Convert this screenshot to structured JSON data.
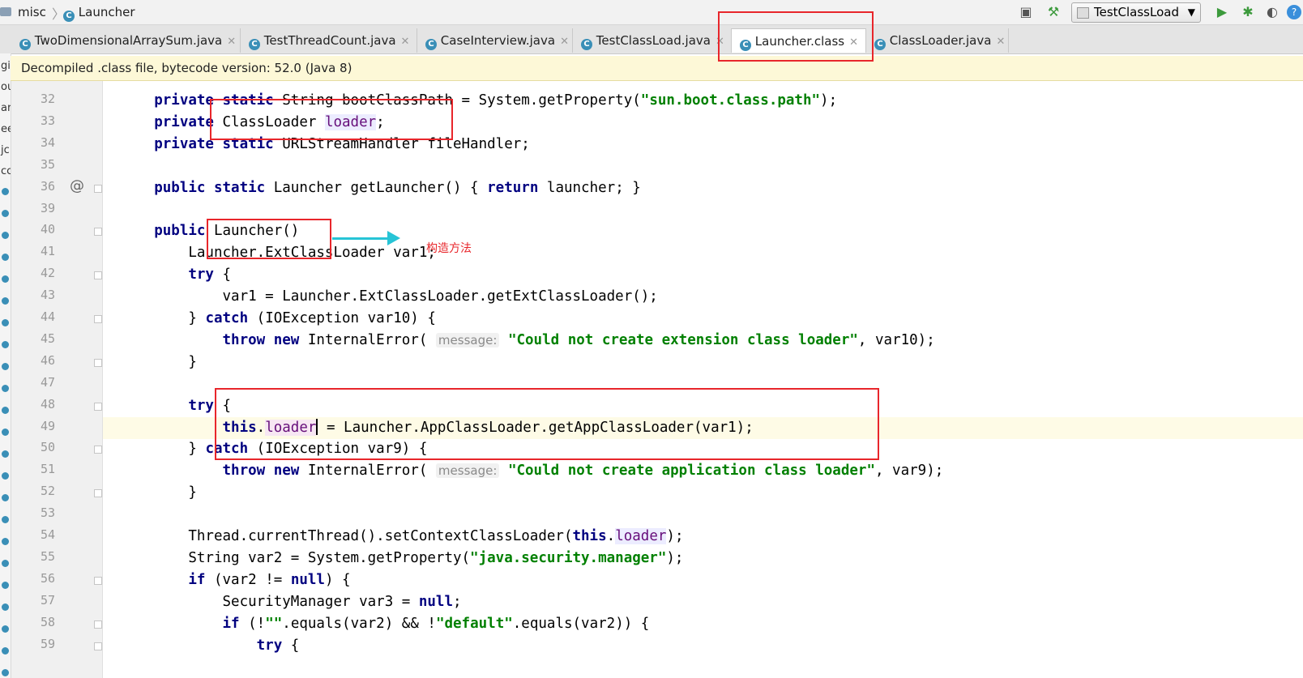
{
  "breadcrumb": {
    "project": "misc",
    "file": "Launcher"
  },
  "toolbar": {
    "run_config": "TestClassLoad"
  },
  "tabs": [
    {
      "label": "TwoDimensionalArraySum.java"
    },
    {
      "label": "TestThreadCount.java"
    },
    {
      "label": "CaseInterview.java"
    },
    {
      "label": "TestClassLoad.java"
    },
    {
      "label": "Launcher.class",
      "active": true
    },
    {
      "label": "ClassLoader.java"
    }
  ],
  "banner": {
    "text": "Decompiled .class file, bytecode version: 52.0 (Java 8)"
  },
  "left_strip": [
    "gi",
    "ou",
    "ar",
    "ee",
    "jc",
    "cc"
  ],
  "gutter": {
    "line_numbers": [
      "32",
      "33",
      "34",
      "35",
      "36",
      "39",
      "40",
      "41",
      "42",
      "43",
      "44",
      "45",
      "46",
      "47",
      "48",
      "49",
      "50",
      "51",
      "52",
      "53",
      "54",
      "55",
      "56",
      "57",
      "58",
      "59"
    ]
  },
  "code": {
    "lines": [
      {
        "t": [
          [
            "kw",
            "private static "
          ],
          [
            "",
            "String bootClassPath = System.getProperty("
          ],
          [
            "str",
            "\"sun.boot.class.path\""
          ],
          [
            "",
            ");"
          ]
        ]
      },
      {
        "t": [
          [
            "kw",
            "private "
          ],
          [
            "",
            "ClassLoader "
          ],
          [
            "fld",
            "loader"
          ],
          [
            "",
            ";"
          ]
        ]
      },
      {
        "t": [
          [
            "kw",
            "private static "
          ],
          [
            "",
            "URLStreamHandler fileHandler;"
          ]
        ]
      },
      {
        "t": [
          [
            "",
            ""
          ]
        ]
      },
      {
        "t": [
          [
            "kw",
            "public static "
          ],
          [
            "",
            "Launcher getLauncher() { "
          ],
          [
            "kw",
            "return "
          ],
          [
            "",
            "launcher; }"
          ]
        ]
      },
      {
        "t": [
          [
            "",
            ""
          ]
        ]
      },
      {
        "t": [
          [
            "kw",
            "public "
          ],
          [
            "",
            "Launcher()"
          ]
        ]
      },
      {
        "t": [
          [
            "",
            "    Launcher.ExtClassLoader var1;"
          ]
        ]
      },
      {
        "t": [
          [
            "kw",
            "    try "
          ],
          [
            "",
            "{"
          ]
        ]
      },
      {
        "t": [
          [
            "",
            "        var1 = Launcher.ExtClassLoader.getExtClassLoader();"
          ]
        ]
      },
      {
        "t": [
          [
            "",
            "    } "
          ],
          [
            "kw",
            "catch "
          ],
          [
            "",
            "(IOException var10) {"
          ]
        ]
      },
      {
        "t": [
          [
            "kw",
            "        throw new "
          ],
          [
            "",
            "InternalError( "
          ],
          [
            "hint",
            "message:"
          ],
          [
            "",
            " "
          ],
          [
            "str",
            "\"Could not create extension class loader\""
          ],
          [
            "",
            ", var10);"
          ]
        ]
      },
      {
        "t": [
          [
            "",
            "    }"
          ]
        ]
      },
      {
        "t": [
          [
            "",
            ""
          ]
        ]
      },
      {
        "t": [
          [
            "kw",
            "    try "
          ],
          [
            "",
            "{"
          ]
        ]
      },
      {
        "t": [
          [
            "kw",
            "        this"
          ],
          [
            "",
            "."
          ],
          [
            "fld2",
            "loader"
          ],
          [
            "caret",
            ""
          ],
          [
            "",
            " = Launcher.AppClassLoader.getAppClassLoader(var1);"
          ]
        ],
        "current": true
      },
      {
        "t": [
          [
            "",
            "    } "
          ],
          [
            "kw",
            "catch "
          ],
          [
            "",
            "(IOException var9) {"
          ]
        ]
      },
      {
        "t": [
          [
            "kw",
            "        throw new "
          ],
          [
            "",
            "InternalError( "
          ],
          [
            "hint",
            "message:"
          ],
          [
            "",
            " "
          ],
          [
            "str",
            "\"Could not create application class loader\""
          ],
          [
            "",
            ", var9);"
          ]
        ]
      },
      {
        "t": [
          [
            "",
            "    }"
          ]
        ]
      },
      {
        "t": [
          [
            "",
            ""
          ]
        ]
      },
      {
        "t": [
          [
            "",
            "    Thread.currentThread().setContextClassLoader("
          ],
          [
            "kw",
            "this"
          ],
          [
            "",
            "."
          ],
          [
            "fld",
            "loader"
          ],
          [
            "",
            ");"
          ]
        ]
      },
      {
        "t": [
          [
            "",
            "    String var2 = System.getProperty("
          ],
          [
            "str",
            "\"java.security.manager\""
          ],
          [
            "",
            ");"
          ]
        ]
      },
      {
        "t": [
          [
            "kw",
            "    if "
          ],
          [
            "",
            "(var2 != "
          ],
          [
            "kw",
            "null"
          ],
          [
            "",
            ") {"
          ]
        ]
      },
      {
        "t": [
          [
            "",
            "        SecurityManager var3 = "
          ],
          [
            "kw",
            "null"
          ],
          [
            "",
            ";"
          ]
        ]
      },
      {
        "t": [
          [
            "kw",
            "        if "
          ],
          [
            "",
            "(!"
          ],
          [
            "str",
            "\"\""
          ],
          [
            "",
            ".equals(var2) && !"
          ],
          [
            "str",
            "\"default\""
          ],
          [
            "",
            ".equals(var2)) {"
          ]
        ]
      },
      {
        "t": [
          [
            "kw",
            "            try "
          ],
          [
            "",
            "{"
          ]
        ]
      }
    ]
  },
  "annotation": {
    "note": "构造方法",
    "highlight_color": "#e8262b",
    "arrow_color": "#27c4d6"
  }
}
